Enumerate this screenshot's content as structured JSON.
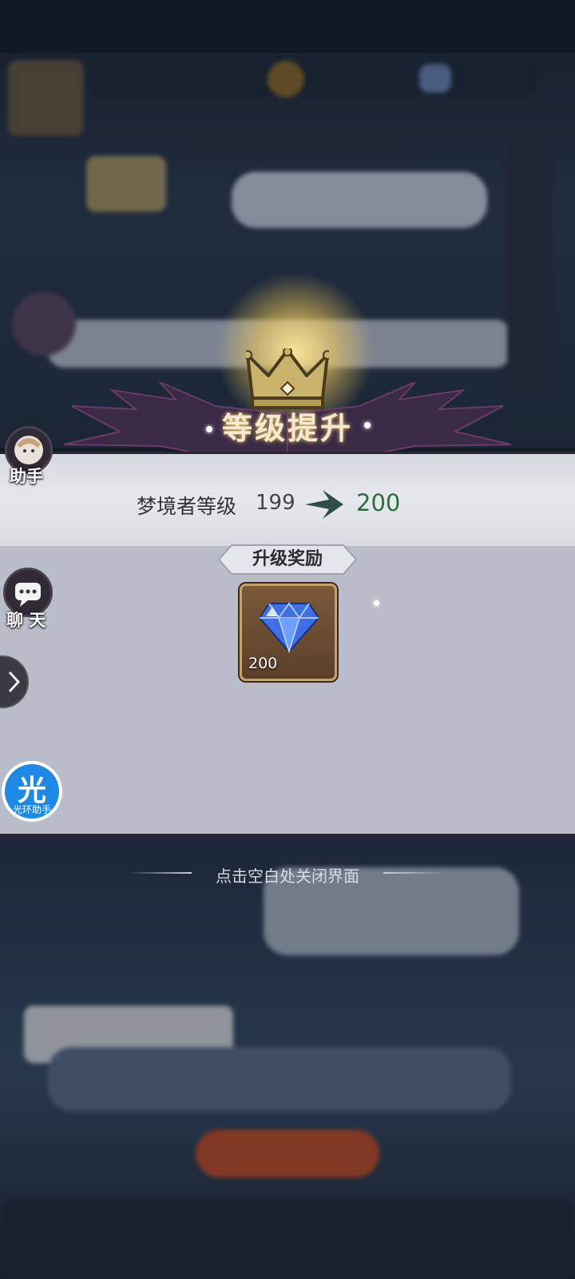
{
  "banner": {
    "title": "等级提升"
  },
  "level": {
    "label": "梦境者等级",
    "old_value": "199",
    "new_value": "200"
  },
  "rewards": {
    "header": "升级奖励",
    "items": [
      {
        "icon": "diamond-icon",
        "count": "200"
      }
    ]
  },
  "side_buttons": {
    "assistant_label": "助手",
    "chat_label": "聊 天",
    "guanghuan_char": "光",
    "guanghuan_label": "光环助手"
  },
  "close_hint": "点击空白处关闭界面",
  "colors": {
    "accent_green": "#2e6e45",
    "panel_gray": "#b8bdc9",
    "item_brown": "#6a4a30"
  }
}
